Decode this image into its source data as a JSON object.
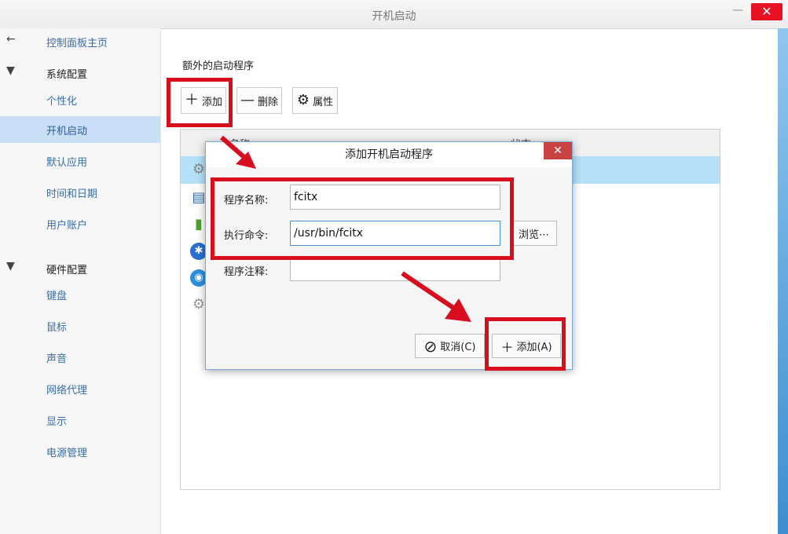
{
  "window": {
    "title": "开机启动",
    "min_glyph": "—",
    "close_glyph": "✕"
  },
  "sidebar": {
    "back_glyph": "←",
    "collapse_glyph": "▼",
    "home": "控制面板主页",
    "groups": [
      {
        "label": "系统配置",
        "items": [
          "个性化",
          "开机启动",
          "默认应用",
          "时间和日期",
          "用户账户"
        ]
      },
      {
        "label": "硬件配置",
        "items": [
          "键盘",
          "鼠标",
          "声音",
          "网络代理",
          "显示",
          "电源管理"
        ]
      }
    ],
    "active": "开机启动"
  },
  "main": {
    "section_title": "额外的启动程序",
    "toolbar": {
      "add": "添加",
      "add_glyph": "＋",
      "delete": "删除",
      "delete_glyph": "—",
      "props": "属性",
      "props_glyph": "⚙"
    },
    "list": {
      "col_name": "名称",
      "col_status": "状态"
    }
  },
  "dialog": {
    "title": "添加开机启动程序",
    "close_glyph": "✕",
    "name_label": "程序名称:",
    "name_value": "fcitx",
    "cmd_label": "执行命令:",
    "cmd_value": "/usr/bin/fcitx",
    "comment_label": "程序注释:",
    "comment_value": "",
    "browse": "浏览⋯",
    "cancel": "取消(C)",
    "cancel_glyph": "⊘",
    "add": "添加(A)",
    "add_glyph": "＋"
  },
  "colors": {
    "highlight": "#d80e1e",
    "selection": "#b5e1f8",
    "sidebar_active": "#c8dff5"
  }
}
